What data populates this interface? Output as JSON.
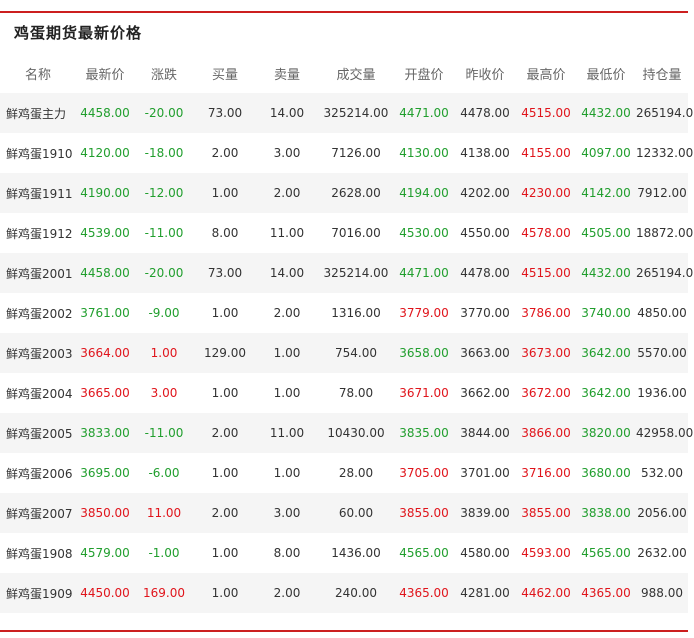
{
  "panel": {
    "title": "鸡蛋期货最新价格"
  },
  "table": {
    "headers": [
      "名称",
      "最新价",
      "涨跌",
      "买量",
      "卖量",
      "成交量",
      "开盘价",
      "昨收价",
      "最高价",
      "最低价",
      "持仓量"
    ],
    "rows": [
      {
        "name": "鲜鸡蛋主力",
        "latest": "4458.00",
        "change": "-20.00",
        "bid_vol": "73.00",
        "ask_vol": "14.00",
        "volume": "325214.00",
        "open": "4471.00",
        "prev_close": "4478.00",
        "high": "4515.00",
        "low": "4432.00",
        "open_interest": "265194.00",
        "latest_color": "down",
        "change_color": "down",
        "open_color": "down",
        "high_color": "up",
        "low_color": "down"
      },
      {
        "name": "鲜鸡蛋1910",
        "latest": "4120.00",
        "change": "-18.00",
        "bid_vol": "2.00",
        "ask_vol": "3.00",
        "volume": "7126.00",
        "open": "4130.00",
        "prev_close": "4138.00",
        "high": "4155.00",
        "low": "4097.00",
        "open_interest": "12332.00",
        "latest_color": "down",
        "change_color": "down",
        "open_color": "down",
        "high_color": "up",
        "low_color": "down"
      },
      {
        "name": "鲜鸡蛋1911",
        "latest": "4190.00",
        "change": "-12.00",
        "bid_vol": "1.00",
        "ask_vol": "2.00",
        "volume": "2628.00",
        "open": "4194.00",
        "prev_close": "4202.00",
        "high": "4230.00",
        "low": "4142.00",
        "open_interest": "7912.00",
        "latest_color": "down",
        "change_color": "down",
        "open_color": "down",
        "high_color": "up",
        "low_color": "down"
      },
      {
        "name": "鲜鸡蛋1912",
        "latest": "4539.00",
        "change": "-11.00",
        "bid_vol": "8.00",
        "ask_vol": "11.00",
        "volume": "7016.00",
        "open": "4530.00",
        "prev_close": "4550.00",
        "high": "4578.00",
        "low": "4505.00",
        "open_interest": "18872.00",
        "latest_color": "down",
        "change_color": "down",
        "open_color": "down",
        "high_color": "up",
        "low_color": "down"
      },
      {
        "name": "鲜鸡蛋2001",
        "latest": "4458.00",
        "change": "-20.00",
        "bid_vol": "73.00",
        "ask_vol": "14.00",
        "volume": "325214.00",
        "open": "4471.00",
        "prev_close": "4478.00",
        "high": "4515.00",
        "low": "4432.00",
        "open_interest": "265194.00",
        "latest_color": "down",
        "change_color": "down",
        "open_color": "down",
        "high_color": "up",
        "low_color": "down"
      },
      {
        "name": "鲜鸡蛋2002",
        "latest": "3761.00",
        "change": "-9.00",
        "bid_vol": "1.00",
        "ask_vol": "2.00",
        "volume": "1316.00",
        "open": "3779.00",
        "prev_close": "3770.00",
        "high": "3786.00",
        "low": "3740.00",
        "open_interest": "4850.00",
        "latest_color": "down",
        "change_color": "down",
        "open_color": "up",
        "high_color": "up",
        "low_color": "down"
      },
      {
        "name": "鲜鸡蛋2003",
        "latest": "3664.00",
        "change": "1.00",
        "bid_vol": "129.00",
        "ask_vol": "1.00",
        "volume": "754.00",
        "open": "3658.00",
        "prev_close": "3663.00",
        "high": "3673.00",
        "low": "3642.00",
        "open_interest": "5570.00",
        "latest_color": "up",
        "change_color": "up",
        "open_color": "down",
        "high_color": "up",
        "low_color": "down"
      },
      {
        "name": "鲜鸡蛋2004",
        "latest": "3665.00",
        "change": "3.00",
        "bid_vol": "1.00",
        "ask_vol": "1.00",
        "volume": "78.00",
        "open": "3671.00",
        "prev_close": "3662.00",
        "high": "3672.00",
        "low": "3642.00",
        "open_interest": "1936.00",
        "latest_color": "up",
        "change_color": "up",
        "open_color": "up",
        "high_color": "up",
        "low_color": "down"
      },
      {
        "name": "鲜鸡蛋2005",
        "latest": "3833.00",
        "change": "-11.00",
        "bid_vol": "2.00",
        "ask_vol": "11.00",
        "volume": "10430.00",
        "open": "3835.00",
        "prev_close": "3844.00",
        "high": "3866.00",
        "low": "3820.00",
        "open_interest": "42958.00",
        "latest_color": "down",
        "change_color": "down",
        "open_color": "down",
        "high_color": "up",
        "low_color": "down"
      },
      {
        "name": "鲜鸡蛋2006",
        "latest": "3695.00",
        "change": "-6.00",
        "bid_vol": "1.00",
        "ask_vol": "1.00",
        "volume": "28.00",
        "open": "3705.00",
        "prev_close": "3701.00",
        "high": "3716.00",
        "low": "3680.00",
        "open_interest": "532.00",
        "latest_color": "down",
        "change_color": "down",
        "open_color": "up",
        "high_color": "up",
        "low_color": "down"
      },
      {
        "name": "鲜鸡蛋2007",
        "latest": "3850.00",
        "change": "11.00",
        "bid_vol": "2.00",
        "ask_vol": "3.00",
        "volume": "60.00",
        "open": "3855.00",
        "prev_close": "3839.00",
        "high": "3855.00",
        "low": "3838.00",
        "open_interest": "2056.00",
        "latest_color": "up",
        "change_color": "up",
        "open_color": "up",
        "high_color": "up",
        "low_color": "down"
      },
      {
        "name": "鲜鸡蛋1908",
        "latest": "4579.00",
        "change": "-1.00",
        "bid_vol": "1.00",
        "ask_vol": "8.00",
        "volume": "1436.00",
        "open": "4565.00",
        "prev_close": "4580.00",
        "high": "4593.00",
        "low": "4565.00",
        "open_interest": "2632.00",
        "latest_color": "down",
        "change_color": "down",
        "open_color": "down",
        "high_color": "up",
        "low_color": "down"
      },
      {
        "name": "鲜鸡蛋1909",
        "latest": "4450.00",
        "change": "169.00",
        "bid_vol": "1.00",
        "ask_vol": "2.00",
        "volume": "240.00",
        "open": "4365.00",
        "prev_close": "4281.00",
        "high": "4462.00",
        "low": "4365.00",
        "open_interest": "988.00",
        "latest_color": "up",
        "change_color": "up",
        "open_color": "up",
        "high_color": "up",
        "low_color": "up"
      }
    ]
  },
  "colors": {
    "rule": "#cc1f1f",
    "up": "#e0141b",
    "down": "#209e2d",
    "row_stripe": "#f5f5f5",
    "header_text": "#666666"
  }
}
